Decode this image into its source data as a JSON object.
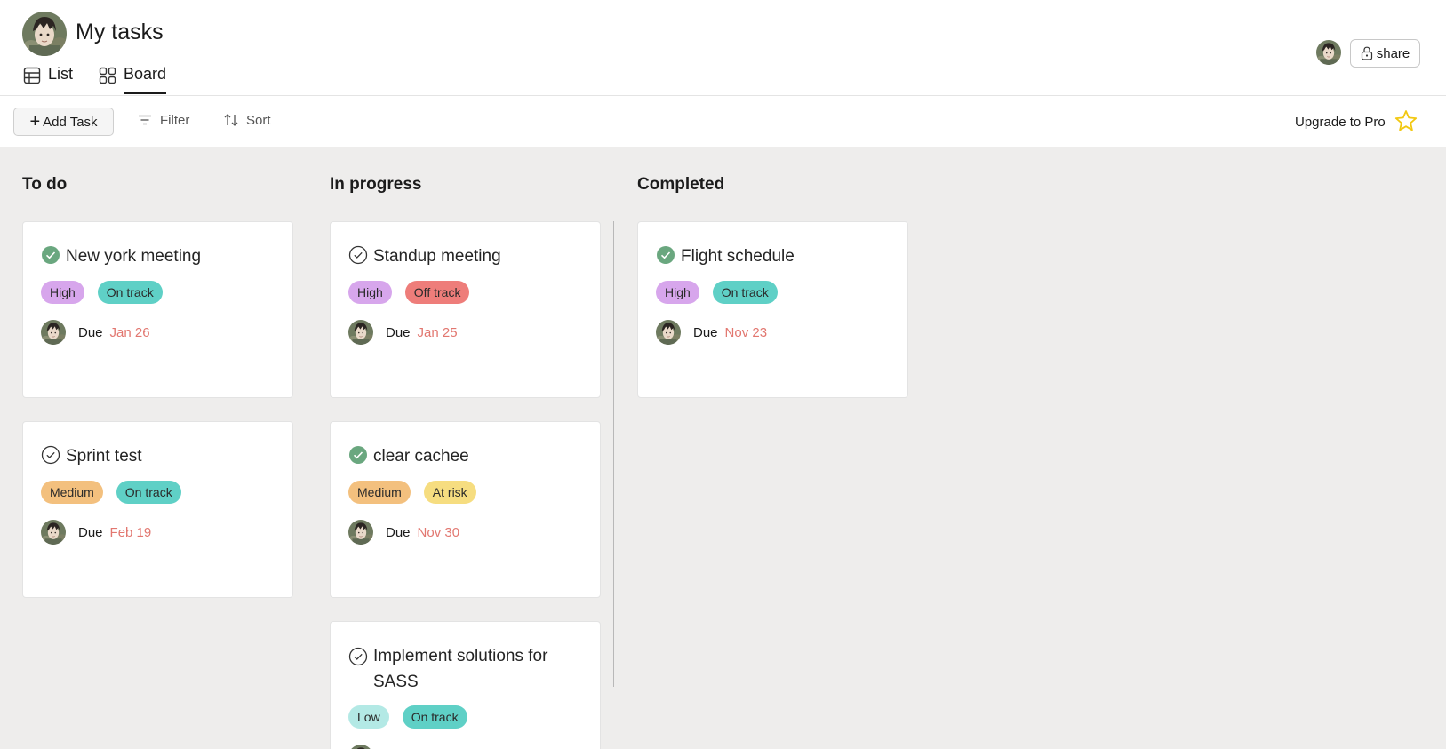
{
  "header": {
    "title": "My tasks",
    "tabs": [
      {
        "label": "List",
        "icon": "table-icon"
      },
      {
        "label": "Board",
        "icon": "grid-icon",
        "active": true
      }
    ],
    "share_label": "share"
  },
  "toolbar": {
    "add_task_label": "Add Task",
    "filter_label": "Filter",
    "sort_label": "Sort",
    "upgrade_label": "Upgrade to Pro"
  },
  "colors": {
    "high": "#d7a6ec",
    "medium": "#f3c07e",
    "low": "#b3e9e5",
    "on_track": "#5fd0c6",
    "off_track": "#ee7d7a",
    "at_risk": "#f6dd80",
    "due_date": "#e27770",
    "star": "#f2c811",
    "check_done": "#6aa77f"
  },
  "columns": [
    {
      "title": "To do",
      "cards": [
        {
          "title": "New york meeting",
          "done": true,
          "priority": "High",
          "status": "On track",
          "due_label": "Due",
          "due": "Jan 26"
        },
        {
          "title": "Sprint test",
          "done": false,
          "priority": "Medium",
          "status": "On track",
          "due_label": "Due",
          "due": "Feb 19"
        }
      ]
    },
    {
      "title": "In progress",
      "cards": [
        {
          "title": "Standup meeting",
          "done": false,
          "priority": "High",
          "status": "Off track",
          "due_label": "Due",
          "due": "Jan 25"
        },
        {
          "title": "clear cachee",
          "done": true,
          "priority": "Medium",
          "status": "At risk",
          "due_label": "Due",
          "due": "Nov 30"
        },
        {
          "title": "Implement solutions for SASS",
          "done": false,
          "priority": "Low",
          "status": "On track"
        }
      ]
    },
    {
      "title": "Completed",
      "cards": [
        {
          "title": "Flight schedule",
          "done": true,
          "priority": "High",
          "status": "On track",
          "due_label": "Due",
          "due": "Nov 23"
        }
      ]
    }
  ]
}
